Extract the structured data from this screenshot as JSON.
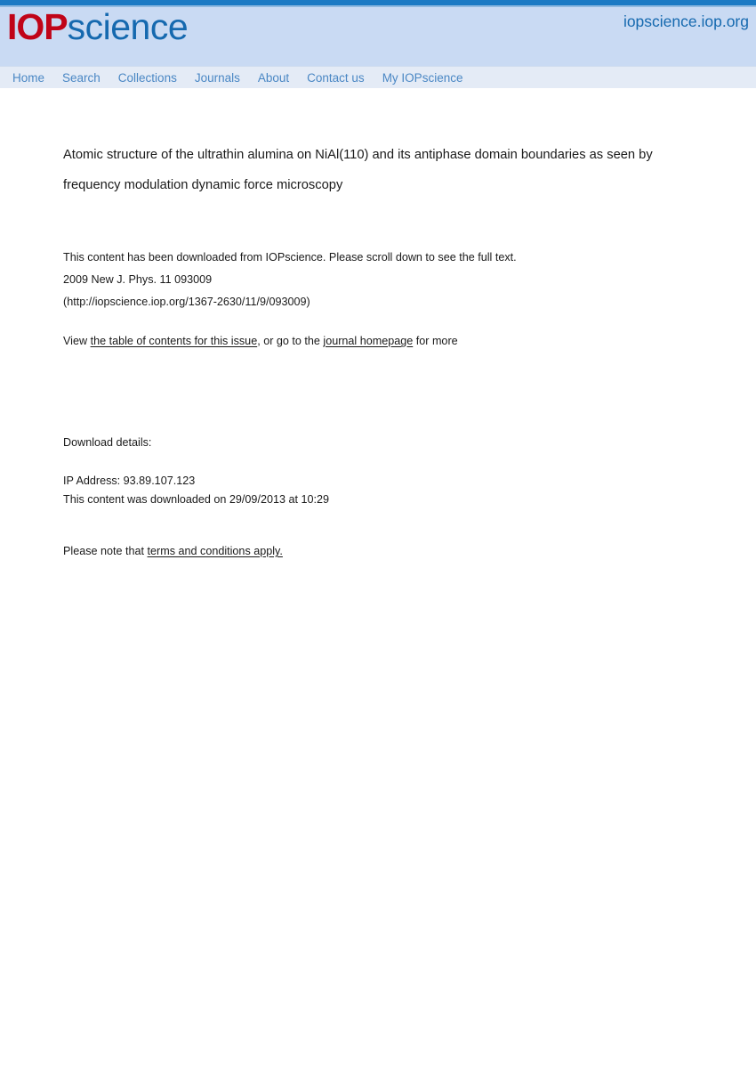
{
  "header": {
    "logo": {
      "part1": "IOP",
      "part2": "science",
      "part1_color": "#c00418",
      "part2_color": "#1569af"
    },
    "site_url": "iopscience.iop.org",
    "band_color": "#c9daf3",
    "topbar_color": "#1b7ac4"
  },
  "nav": {
    "items": [
      {
        "label": "Home"
      },
      {
        "label": "Search"
      },
      {
        "label": "Collections"
      },
      {
        "label": "Journals"
      },
      {
        "label": "About"
      },
      {
        "label": "Contact us"
      },
      {
        "label": "My IOPscience"
      }
    ],
    "bg_color": "#e4ebf6",
    "link_color": "#4a87c4"
  },
  "article": {
    "title": "Atomic structure of the ultrathin alumina on NiAl(110) and its antiphase domain boundaries as seen by frequency modulation dynamic force microscopy"
  },
  "notice": {
    "line1": "This content has been downloaded from IOPscience. Please scroll down to see the full text.",
    "citation": "2009 New J. Phys. 11 093009",
    "url_line": "(http://iopscience.iop.org/1367-2630/11/9/093009)"
  },
  "view_line": {
    "prefix": "View ",
    "link1": "the table of contents for this issue",
    "middle": ", or go to the ",
    "link2": "journal homepage",
    "suffix": " for more"
  },
  "download": {
    "heading": "Download details:",
    "ip_address": "IP Address: 93.89.107.123",
    "downloaded_on": "This content was downloaded on 29/09/2013 at 10:29"
  },
  "terms": {
    "prefix": "Please note that ",
    "link": "terms and conditions apply."
  }
}
